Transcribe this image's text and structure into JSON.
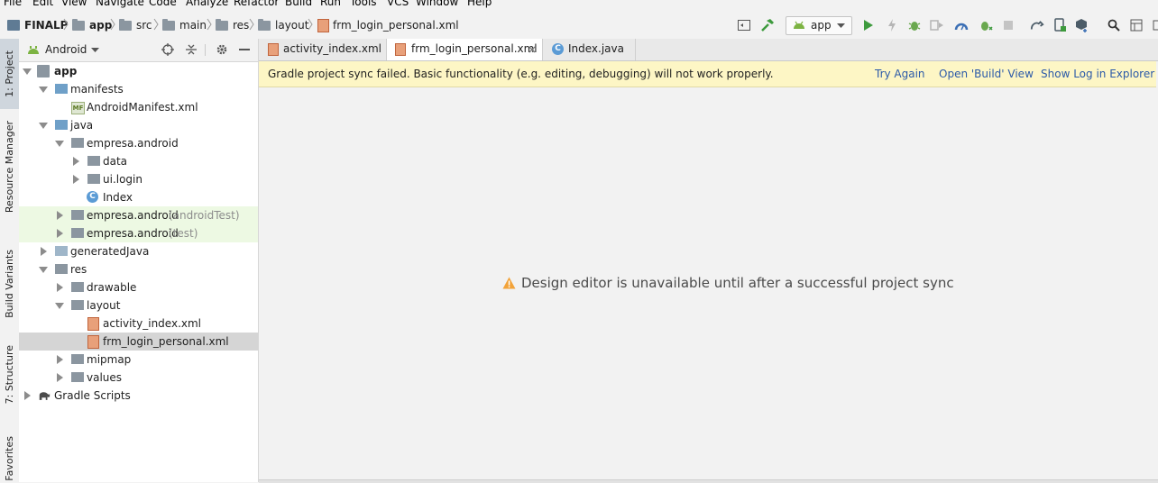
{
  "menu": [
    "File",
    "Edit",
    "View",
    "Navigate",
    "Code",
    "Analyze",
    "Refactor",
    "Build",
    "Run",
    "Tools",
    "VCS",
    "Window",
    "Help"
  ],
  "breadcrumb": [
    "FINALP",
    "app",
    "src",
    "main",
    "res",
    "layout",
    "frm_login_personal.xml"
  ],
  "toolbar": {
    "run_config": "app",
    "icons": [
      "hammer-icon",
      "run-icon",
      "apply-changes-icon",
      "debug-icon",
      "profile-icon",
      "attach-debugger-icon",
      "stop-icon",
      "avd-manager-icon",
      "sdk-manager-icon",
      "sync-icon",
      "search-icon",
      "more-icon"
    ]
  },
  "left_stripe": {
    "project": "1: Project",
    "resource_manager": "Resource Manager",
    "build_variants": "Build Variants",
    "structure": "7: Structure",
    "favorites": "Favorites"
  },
  "project_panel": {
    "view_mode": "Android",
    "tree": [
      {
        "label": "app",
        "state": "open",
        "bold": true
      },
      {
        "label": "manifests",
        "state": "open"
      },
      {
        "label": "AndroidManifest.xml",
        "state": "leaf"
      },
      {
        "label": "java",
        "state": "open"
      },
      {
        "label": "empresa.android",
        "state": "open"
      },
      {
        "label": "data",
        "state": "closed"
      },
      {
        "label": "ui.login",
        "state": "closed"
      },
      {
        "label": "Index",
        "state": "leaf"
      },
      {
        "label": "empresa.android",
        "suffix": "(androidTest)",
        "state": "closed"
      },
      {
        "label": "empresa.android",
        "suffix": "(test)",
        "state": "closed"
      },
      {
        "label": "generatedJava",
        "state": "closed"
      },
      {
        "label": "res",
        "state": "open"
      },
      {
        "label": "drawable",
        "state": "closed"
      },
      {
        "label": "layout",
        "state": "open"
      },
      {
        "label": "activity_index.xml",
        "state": "leaf"
      },
      {
        "label": "frm_login_personal.xml",
        "state": "leaf",
        "selected": true
      },
      {
        "label": "mipmap",
        "state": "closed"
      },
      {
        "label": "values",
        "state": "closed"
      },
      {
        "label": "Gradle Scripts",
        "state": "closed"
      }
    ]
  },
  "editor": {
    "tabs": [
      {
        "label": "activity_index.xml",
        "active": false
      },
      {
        "label": "frm_login_personal.xml",
        "active": true
      },
      {
        "label": "Index.java",
        "active": false
      }
    ],
    "banner": {
      "message": "Gradle project sync failed. Basic functionality (e.g. editing, debugging) will not work properly.",
      "try_again": "Try Again",
      "open_build": "Open 'Build' View",
      "show_log": "Show Log in Explorer"
    },
    "design_message": "Design editor is unavailable until after a successful project sync"
  },
  "colors": {
    "accent_green": "#3d9a3d",
    "banner": "#fdf6c5",
    "link": "#2c5aa8",
    "selection": "#d5d5d5",
    "test_bg": "#edf9e3"
  }
}
